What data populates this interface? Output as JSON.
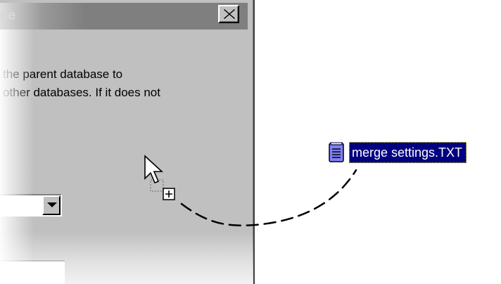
{
  "dialog": {
    "title": "se",
    "close_label": "Close",
    "description_lines": [
      "the parent database to",
      "other databases. If it does not"
    ],
    "combo_value": ""
  },
  "file": {
    "name": "merge settings.TXT",
    "icon": "text-file-icon"
  },
  "cursor": {
    "icon": "arrow-copy-cursor-icon"
  },
  "colors": {
    "dialog_face": "#c0c0c0",
    "titlebar_inactive": "#808080",
    "selection": "#000080",
    "file_icon": "#8080ff"
  }
}
